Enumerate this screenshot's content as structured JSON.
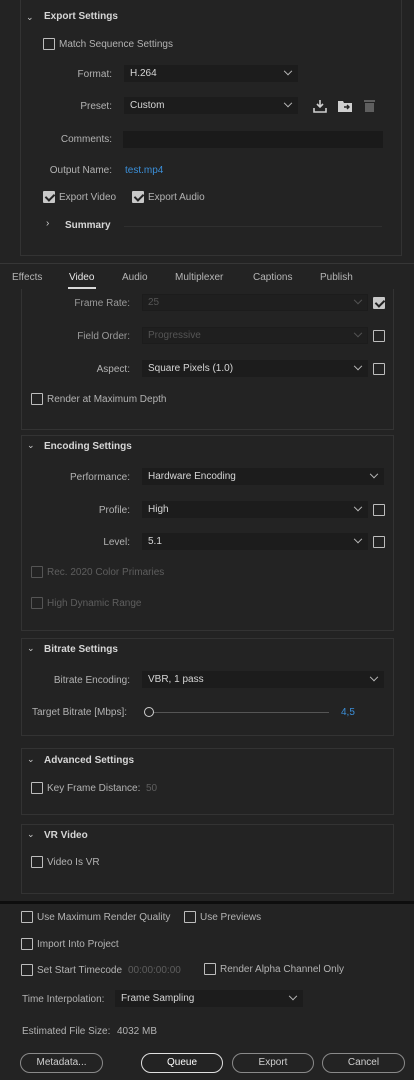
{
  "export_settings": {
    "title": "Export Settings",
    "match_sequence": "Match Sequence Settings",
    "format_label": "Format:",
    "format_value": "H.264",
    "preset_label": "Preset:",
    "preset_value": "Custom",
    "comments_label": "Comments:",
    "output_label": "Output Name:",
    "output_value": "test.mp4",
    "export_video": "Export Video",
    "export_audio": "Export Audio",
    "summary": "Summary"
  },
  "tabs": [
    "Effects",
    "Video",
    "Audio",
    "Multiplexer",
    "Captions",
    "Publish"
  ],
  "video_basic": {
    "frame_rate_label": "Frame Rate:",
    "frame_rate_value": "25",
    "field_order_label": "Field Order:",
    "field_order_value": "Progressive",
    "aspect_label": "Aspect:",
    "aspect_value": "Square Pixels (1.0)",
    "render_max_depth": "Render at Maximum Depth"
  },
  "encoding": {
    "title": "Encoding Settings",
    "performance_label": "Performance:",
    "performance_value": "Hardware Encoding",
    "profile_label": "Profile:",
    "profile_value": "High",
    "level_label": "Level:",
    "level_value": "5.1",
    "rec2020": "Rec. 2020 Color Primaries",
    "hdr": "High Dynamic Range"
  },
  "bitrate": {
    "title": "Bitrate Settings",
    "encoding_label": "Bitrate Encoding:",
    "encoding_value": "VBR, 1 pass",
    "target_label": "Target Bitrate [Mbps]:",
    "target_value": "4,5"
  },
  "advanced": {
    "title": "Advanced Settings",
    "key_frame": "Key Frame Distance:",
    "key_frame_value": "50"
  },
  "vr": {
    "title": "VR Video",
    "video_is_vr": "Video Is VR"
  },
  "bottom": {
    "max_render_quality": "Use Maximum Render Quality",
    "use_previews": "Use Previews",
    "import_project": "Import Into Project",
    "set_start_timecode": "Set Start Timecode",
    "timecode_value": "00:00:00:00",
    "render_alpha": "Render Alpha Channel Only",
    "time_interp_label": "Time Interpolation:",
    "time_interp_value": "Frame Sampling",
    "est_size_label": "Estimated File Size:",
    "est_size_value": "4032 MB"
  },
  "buttons": {
    "metadata": "Metadata...",
    "queue": "Queue",
    "export": "Export",
    "cancel": "Cancel"
  },
  "icons": [
    "chevron-down-icon",
    "chevron-right-icon",
    "import-preset-icon",
    "save-preset-icon",
    "trash-icon",
    "checkbox-icon"
  ],
  "colors": {
    "background": "#232323",
    "link": "#3b8fd9",
    "field": "#1c1c1c"
  }
}
